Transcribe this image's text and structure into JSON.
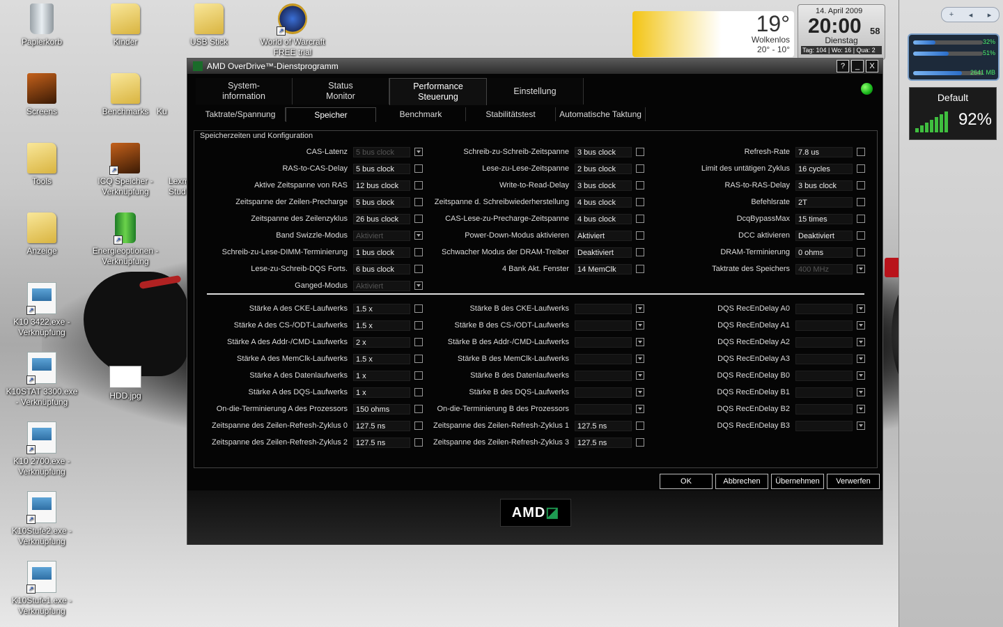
{
  "desktop": {
    "icons": [
      {
        "label": "Papierkorb",
        "kind": "bin",
        "shortcut": false
      },
      {
        "label": "Kinder",
        "kind": "folder",
        "shortcut": false
      },
      {
        "label": "USB Stick",
        "kind": "folder",
        "shortcut": false
      },
      {
        "label": "World of Warcraft FREE trial",
        "kind": "wow",
        "shortcut": true
      },
      {
        "label": "Screens",
        "kind": "folder-dark",
        "shortcut": false
      },
      {
        "label": "Benchmarks",
        "kind": "folder",
        "shortcut": false
      },
      {
        "label": "Tools",
        "kind": "folder",
        "shortcut": false
      },
      {
        "label": "ICQ Speicher - Verknüpfung",
        "kind": "folder-dark",
        "shortcut": true
      },
      {
        "label": "Anzeige",
        "kind": "folder",
        "shortcut": false
      },
      {
        "label": "Energieoptionen - Verknüpfung",
        "kind": "battery",
        "shortcut": true
      },
      {
        "label": "K10 3422.exe - Verknüpfung",
        "kind": "exe",
        "shortcut": true
      },
      {
        "label": "K10STAT 3300.exe - Verknüpfung",
        "kind": "exe",
        "shortcut": true
      },
      {
        "label": "HDD.jpg",
        "kind": "jpg",
        "shortcut": false
      },
      {
        "label": "K10 2700.exe - Verknüpfung",
        "kind": "exe",
        "shortcut": true
      },
      {
        "label": "K10Stufe2.exe - Verknüpfung",
        "kind": "exe",
        "shortcut": true
      },
      {
        "label": "K10Stufe1.exe - Verknüpfung",
        "kind": "exe",
        "shortcut": true
      }
    ],
    "partial_labels": [
      "Ku",
      "Lexm Stud"
    ]
  },
  "weather": {
    "temp": "19°",
    "condition": "Wolkenlos",
    "range": "20° - 10°"
  },
  "clock": {
    "date": "14. April 2009",
    "time": "20:00",
    "seconds": "58",
    "day": "Dienstag",
    "info": "Tag: 104 | Wo: 16 | Qua: 2"
  },
  "sidebar": {
    "meter": {
      "cpu1": "32%",
      "cpu1_level": 0.32,
      "cpu2": "51%",
      "cpu2_level": 0.51,
      "ram": "2641 MB",
      "ram_level": 0.7
    },
    "wifi": {
      "name": "Default",
      "percent": "92%"
    }
  },
  "window": {
    "title": "AMD OverDrive™-Dienstprogramm",
    "buttons": {
      "help": "?",
      "minimize": "_",
      "close": "X"
    },
    "main_tabs": [
      {
        "label": "System-\ninformation",
        "active": false
      },
      {
        "label": "Status\nMonitor",
        "active": false
      },
      {
        "label": "Performance\nSteuerung",
        "active": true
      },
      {
        "label": "Einstellung",
        "active": false
      }
    ],
    "sub_tabs": [
      {
        "label": "Taktrate/Spannung",
        "active": false
      },
      {
        "label": "Speicher",
        "active": true
      },
      {
        "label": "Benchmark",
        "active": false
      },
      {
        "label": "Stabilitätstest",
        "active": false
      },
      {
        "label": "Automatische Taktung",
        "active": false
      }
    ],
    "group_title": "Speicherzeiten und Konfiguration",
    "columns_top": [
      [
        {
          "label": "CAS-Latenz",
          "value": "5 bus clock",
          "disabled": true,
          "dropdown": true
        },
        {
          "label": "RAS-to-CAS-Delay",
          "value": "5 bus clock",
          "disabled": false,
          "dropdown": false
        },
        {
          "label": "Aktive Zeitspanne von RAS",
          "value": "12 bus clock",
          "disabled": false,
          "dropdown": false
        },
        {
          "label": "Zeitspanne der Zeilen-Precharge",
          "value": "5 bus clock",
          "disabled": false,
          "dropdown": false
        },
        {
          "label": "Zeitspanne des Zeilenzyklus",
          "value": "26 bus clock",
          "disabled": false,
          "dropdown": false
        },
        {
          "label": "Band Swizzle-Modus",
          "value": "Aktiviert",
          "disabled": true,
          "dropdown": true
        },
        {
          "label": "Schreib-zu-Lese-DIMM-Terminierung",
          "value": "1 bus clock",
          "disabled": false,
          "dropdown": false
        },
        {
          "label": "Lese-zu-Schreib-DQS Forts.",
          "value": "6 bus clock",
          "disabled": false,
          "dropdown": false
        },
        {
          "label": "Ganged-Modus",
          "value": "Aktiviert",
          "disabled": true,
          "dropdown": true
        }
      ],
      [
        {
          "label": "Schreib-zu-Schreib-Zeitspanne",
          "value": "3 bus clock",
          "disabled": false,
          "dropdown": false
        },
        {
          "label": "Lese-zu-Lese-Zeitspanne",
          "value": "2 bus clock",
          "disabled": false,
          "dropdown": false
        },
        {
          "label": "Write-to-Read-Delay",
          "value": "3 bus clock",
          "disabled": false,
          "dropdown": false
        },
        {
          "label": "Zeitspanne d. Schreibwiederherstellung",
          "value": "4 bus clock",
          "disabled": false,
          "dropdown": false
        },
        {
          "label": "CAS-Lese-zu-Precharge-Zeitspanne",
          "value": "4 bus clock",
          "disabled": false,
          "dropdown": false
        },
        {
          "label": "Power-Down-Modus aktivieren",
          "value": "Aktiviert",
          "disabled": false,
          "dropdown": false
        },
        {
          "label": "Schwacher Modus der DRAM-Treiber",
          "value": "Deaktiviert",
          "disabled": false,
          "dropdown": false
        },
        {
          "label": "4 Bank Akt. Fenster",
          "value": "14 MemClk",
          "disabled": false,
          "dropdown": false
        }
      ],
      [
        {
          "label": "Refresh-Rate",
          "value": "7.8 us",
          "disabled": false,
          "dropdown": false
        },
        {
          "label": "Limit des untätigen Zyklus",
          "value": "16 cycles",
          "disabled": false,
          "dropdown": false
        },
        {
          "label": "RAS-to-RAS-Delay",
          "value": "3 bus clock",
          "disabled": false,
          "dropdown": false
        },
        {
          "label": "Befehlsrate",
          "value": "2T",
          "disabled": false,
          "dropdown": false
        },
        {
          "label": "DcqBypassMax",
          "value": "15 times",
          "disabled": false,
          "dropdown": false
        },
        {
          "label": "DCC aktivieren",
          "value": "Deaktiviert",
          "disabled": false,
          "dropdown": false
        },
        {
          "label": "DRAM-Terminierung",
          "value": "0 ohms",
          "disabled": false,
          "dropdown": false
        },
        {
          "label": "Taktrate des Speichers",
          "value": "400 MHz",
          "disabled": true,
          "dropdown": true
        }
      ]
    ],
    "columns_bottom": [
      [
        {
          "label": "Stärke A des CKE-Laufwerks",
          "value": "1.5 x",
          "disabled": false,
          "dropdown": false
        },
        {
          "label": "Stärke A des CS-/ODT-Laufwerks",
          "value": "1.5 x",
          "disabled": false,
          "dropdown": false
        },
        {
          "label": "Stärke A des Addr-/CMD-Laufwerks",
          "value": "2 x",
          "disabled": false,
          "dropdown": false
        },
        {
          "label": "Stärke A des MemClk-Laufwerks",
          "value": "1.5 x",
          "disabled": false,
          "dropdown": false
        },
        {
          "label": "Stärke A des Datenlaufwerks",
          "value": "1 x",
          "disabled": false,
          "dropdown": false
        },
        {
          "label": "Stärke A des DQS-Laufwerks",
          "value": "1 x",
          "disabled": false,
          "dropdown": false
        },
        {
          "label": "On-die-Terminierung A des Prozessors",
          "value": "150 ohms",
          "disabled": false,
          "dropdown": false
        },
        {
          "label": "Zeitspanne des Zeilen-Refresh-Zyklus 0",
          "value": "127.5 ns",
          "disabled": false,
          "dropdown": false
        },
        {
          "label": "Zeitspanne des Zeilen-Refresh-Zyklus 2",
          "value": "127.5 ns",
          "disabled": false,
          "dropdown": false
        }
      ],
      [
        {
          "label": "Stärke B des CKE-Laufwerks",
          "value": "",
          "disabled": false,
          "dropdown": true
        },
        {
          "label": "Stärke B des CS-/ODT-Laufwerks",
          "value": "",
          "disabled": false,
          "dropdown": true
        },
        {
          "label": "Stärke B des Addr-/CMD-Laufwerks",
          "value": "",
          "disabled": false,
          "dropdown": true
        },
        {
          "label": "Stärke B des MemClk-Laufwerks",
          "value": "",
          "disabled": false,
          "dropdown": true
        },
        {
          "label": "Stärke B des Datenlaufwerks",
          "value": "",
          "disabled": false,
          "dropdown": true
        },
        {
          "label": "Stärke B des DQS-Laufwerks",
          "value": "",
          "disabled": false,
          "dropdown": true
        },
        {
          "label": "On-die-Terminierung B des Prozessors",
          "value": "",
          "disabled": false,
          "dropdown": true
        },
        {
          "label": "Zeitspanne des Zeilen-Refresh-Zyklus 1",
          "value": "127.5 ns",
          "disabled": false,
          "dropdown": false
        },
        {
          "label": "Zeitspanne des Zeilen-Refresh-Zyklus 3",
          "value": "127.5 ns",
          "disabled": false,
          "dropdown": false
        }
      ],
      [
        {
          "label": "DQS RecEnDelay A0",
          "value": "",
          "disabled": false,
          "dropdown": true
        },
        {
          "label": "DQS RecEnDelay A1",
          "value": "",
          "disabled": false,
          "dropdown": true
        },
        {
          "label": "DQS RecEnDelay A2",
          "value": "",
          "disabled": false,
          "dropdown": true
        },
        {
          "label": "DQS RecEnDelay A3",
          "value": "",
          "disabled": false,
          "dropdown": true
        },
        {
          "label": "DQS RecEnDelay B0",
          "value": "",
          "disabled": false,
          "dropdown": true
        },
        {
          "label": "DQS RecEnDelay B1",
          "value": "",
          "disabled": false,
          "dropdown": true
        },
        {
          "label": "DQS RecEnDelay B2",
          "value": "",
          "disabled": false,
          "dropdown": true
        },
        {
          "label": "DQS RecEnDelay B3",
          "value": "",
          "disabled": false,
          "dropdown": true
        }
      ]
    ],
    "dialog_buttons": {
      "ok": "OK",
      "cancel": "Abbrechen",
      "apply": "Übernehmen",
      "discard": "Verwerfen"
    },
    "logo_text": "AMD",
    "logo_mark": "◪"
  }
}
